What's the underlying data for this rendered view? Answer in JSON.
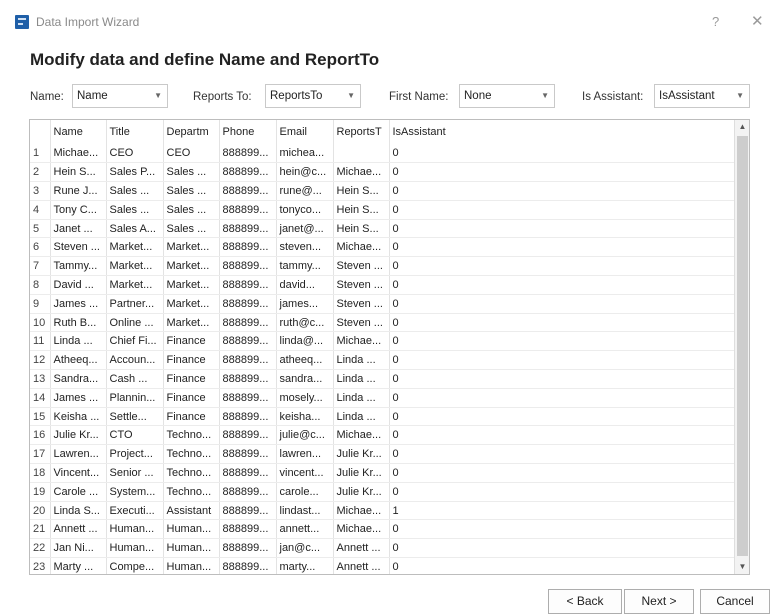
{
  "window": {
    "title": "Data Import Wizard",
    "help": "?",
    "close": "✕"
  },
  "heading": "Modify data and define Name and ReportTo",
  "mapping": {
    "name_label": "Name:",
    "name_value": "Name",
    "reports_to_label": "Reports To:",
    "reports_to_value": "ReportsTo",
    "first_name_label": "First Name:",
    "first_name_value": "None",
    "is_assistant_label": "Is Assistant:",
    "is_assistant_value": "IsAssistant"
  },
  "grid": {
    "columns": [
      "",
      "Name",
      "Title",
      "Departm",
      "Phone",
      "Email",
      "ReportsT",
      "IsAssistant"
    ],
    "rows": [
      [
        "1",
        "Michae...",
        "CEO",
        "CEO",
        "888899...",
        "michea...",
        "",
        "0"
      ],
      [
        "2",
        "Hein S...",
        "Sales P...",
        "Sales ...",
        "888899...",
        "hein@c...",
        "Michae...",
        "0"
      ],
      [
        "3",
        "Rune J...",
        "Sales ...",
        "Sales ...",
        "888899...",
        "rune@...",
        "Hein S...",
        "0"
      ],
      [
        "4",
        "Tony C...",
        "Sales ...",
        "Sales ...",
        "888899...",
        "tonyco...",
        "Hein S...",
        "0"
      ],
      [
        "5",
        "Janet ...",
        "Sales A...",
        "Sales ...",
        "888899...",
        "janet@...",
        "Hein S...",
        "0"
      ],
      [
        "6",
        "Steven ...",
        "Market...",
        "Market...",
        "888899...",
        "steven...",
        "Michae...",
        "0"
      ],
      [
        "7",
        "Tammy...",
        "Market...",
        "Market...",
        "888899...",
        "tammy...",
        "Steven ...",
        "0"
      ],
      [
        "8",
        "David ...",
        "Market...",
        "Market...",
        "888899...",
        "david...",
        "Steven ...",
        "0"
      ],
      [
        "9",
        "James ...",
        "Partner...",
        "Market...",
        "888899...",
        "james...",
        "Steven ...",
        "0"
      ],
      [
        "10",
        "Ruth B...",
        "Online ...",
        "Market...",
        "888899...",
        "ruth@c...",
        "Steven ...",
        "0"
      ],
      [
        "11",
        "Linda ...",
        "Chief Fi...",
        "Finance",
        "888899...",
        "linda@...",
        "Michae...",
        "0"
      ],
      [
        "12",
        "Atheeq...",
        "Accoun...",
        "Finance",
        "888899...",
        "atheeq...",
        "Linda ...",
        "0"
      ],
      [
        "13",
        "Sandra...",
        "Cash ...",
        "Finance",
        "888899...",
        "sandra...",
        "Linda ...",
        "0"
      ],
      [
        "14",
        "James ...",
        "Plannin...",
        "Finance",
        "888899...",
        "mosely...",
        "Linda ...",
        "0"
      ],
      [
        "15",
        "Keisha ...",
        "Settle...",
        "Finance",
        "888899...",
        "keisha...",
        "Linda ...",
        "0"
      ],
      [
        "16",
        "Julie Kr...",
        "CTO",
        "Techno...",
        "888899...",
        "julie@c...",
        "Michae...",
        "0"
      ],
      [
        "17",
        "Lawren...",
        "Project...",
        "Techno...",
        "888899...",
        "lawren...",
        "Julie Kr...",
        "0"
      ],
      [
        "18",
        "Vincent...",
        "Senior ...",
        "Techno...",
        "888899...",
        "vincent...",
        "Julie Kr...",
        "0"
      ],
      [
        "19",
        "Carole ...",
        "System...",
        "Techno...",
        "888899...",
        "carole...",
        "Julie Kr...",
        "0"
      ],
      [
        "20",
        "Linda S...",
        "Executi...",
        "Assistant",
        "888899...",
        "lindast...",
        "Michae...",
        "1"
      ],
      [
        "21",
        "Annett ...",
        "Human...",
        "Human...",
        "888899...",
        "annett...",
        "Michae...",
        "0"
      ],
      [
        "22",
        "Jan Ni...",
        "Human...",
        "Human...",
        "888899...",
        "jan@c...",
        "Annett ...",
        "0"
      ],
      [
        "23",
        "Marty ...",
        "Compe...",
        "Human...",
        "888899...",
        "marty...",
        "Annett ...",
        "0"
      ]
    ]
  },
  "buttons": {
    "back": "< Back",
    "next": "Next >",
    "cancel": "Cancel"
  }
}
